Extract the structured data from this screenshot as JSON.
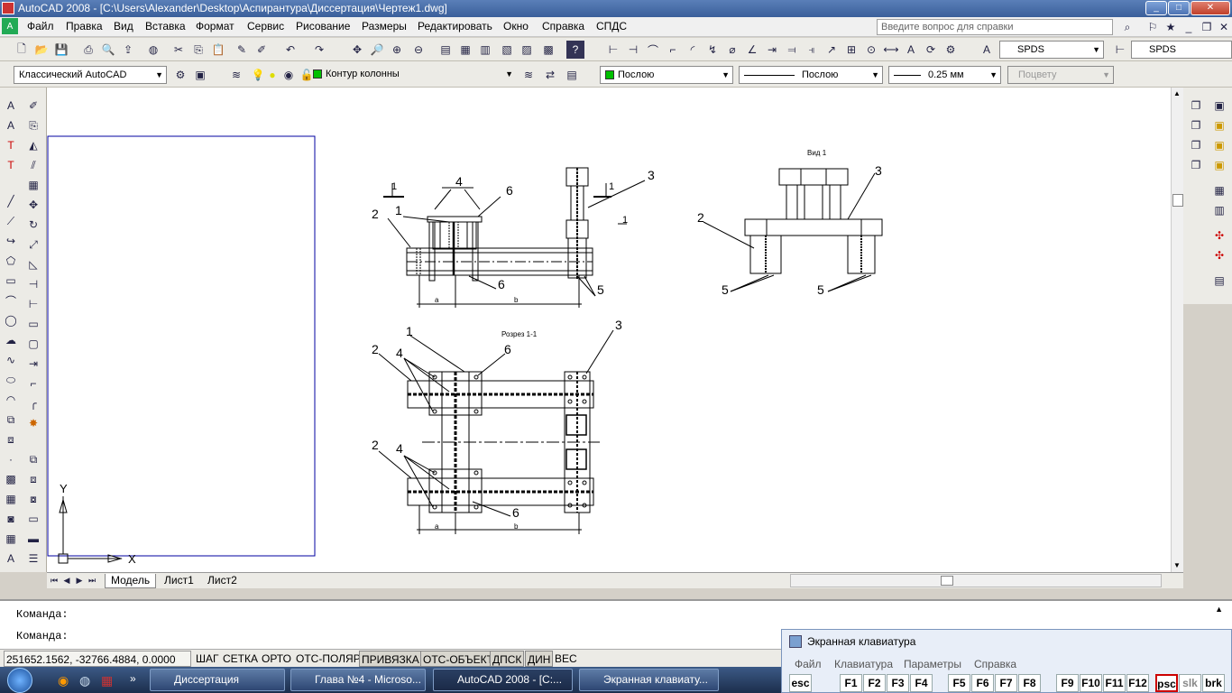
{
  "window": {
    "title": "AutoCAD 2008 - [C:\\Users\\Alexander\\Desktop\\Аспирантура\\Диссертация\\Чертеж1.dwg]",
    "min_label": "_",
    "max_label": "□",
    "close_label": "✕"
  },
  "menu": [
    "Файл",
    "Правка",
    "Вид",
    "Вставка",
    "Формат",
    "Сервис",
    "Рисование",
    "Размеры",
    "Редактировать",
    "Окно",
    "Справка",
    "СПДС"
  ],
  "help_search": {
    "placeholder": "Введите вопрос для справки"
  },
  "toolbar": {
    "workspace": "Классический AutoCAD",
    "layer": "Контур колонны",
    "color": "Послою",
    "linetype": "Послою",
    "lineweight": "0.25 мм",
    "plotstyle": "Поцвету",
    "textstyle1": "SPDS",
    "textstyle2": "SPDS"
  },
  "drawing": {
    "view_label": "Вид 1",
    "section_label": "Розрез 1-1",
    "dim_a": "a",
    "dim_b": "b",
    "callouts": [
      "1",
      "2",
      "3",
      "4",
      "5",
      "6"
    ],
    "section_mark": "1",
    "ucs_x": "X",
    "ucs_y": "Y"
  },
  "layout_tabs": [
    "Модель",
    "Лист1",
    "Лист2"
  ],
  "command": {
    "line1": "Команда:",
    "line2": "Команда:"
  },
  "status": {
    "coords": "251652.1562, -32766.4884, 0.0000",
    "buttons": [
      {
        "label": "ШАГ",
        "on": false
      },
      {
        "label": "СЕТКА",
        "on": false
      },
      {
        "label": "ОРТО",
        "on": false
      },
      {
        "label": "ОТС-ПОЛЯР",
        "on": false
      },
      {
        "label": "ПРИВЯЗКА",
        "on": true
      },
      {
        "label": "ОТС-ОБЪЕКТ",
        "on": true
      },
      {
        "label": "ДПСК",
        "on": true
      },
      {
        "label": "ДИН",
        "on": true
      },
      {
        "label": "ВЕС",
        "on": false
      }
    ]
  },
  "osk": {
    "title": "Экранная клавиатура",
    "menu": [
      "Файл",
      "Клавиатура",
      "Параметры",
      "Справка"
    ],
    "keys": [
      "esc",
      "F1",
      "F2",
      "F3",
      "F4",
      "F5",
      "F6",
      "F7",
      "F8",
      "F9",
      "F10",
      "F11",
      "F12",
      "psc",
      "slk",
      "brk"
    ]
  },
  "taskbar": {
    "items": [
      "Диссертация",
      "Глава №4 - Microso...",
      "AutoCAD 2008 - [C:...",
      "Экранная клавиату..."
    ]
  },
  "colors": {
    "accent": "#3a5f9a",
    "layer_green": "#00c000",
    "selection_rect": "#0000a0"
  }
}
